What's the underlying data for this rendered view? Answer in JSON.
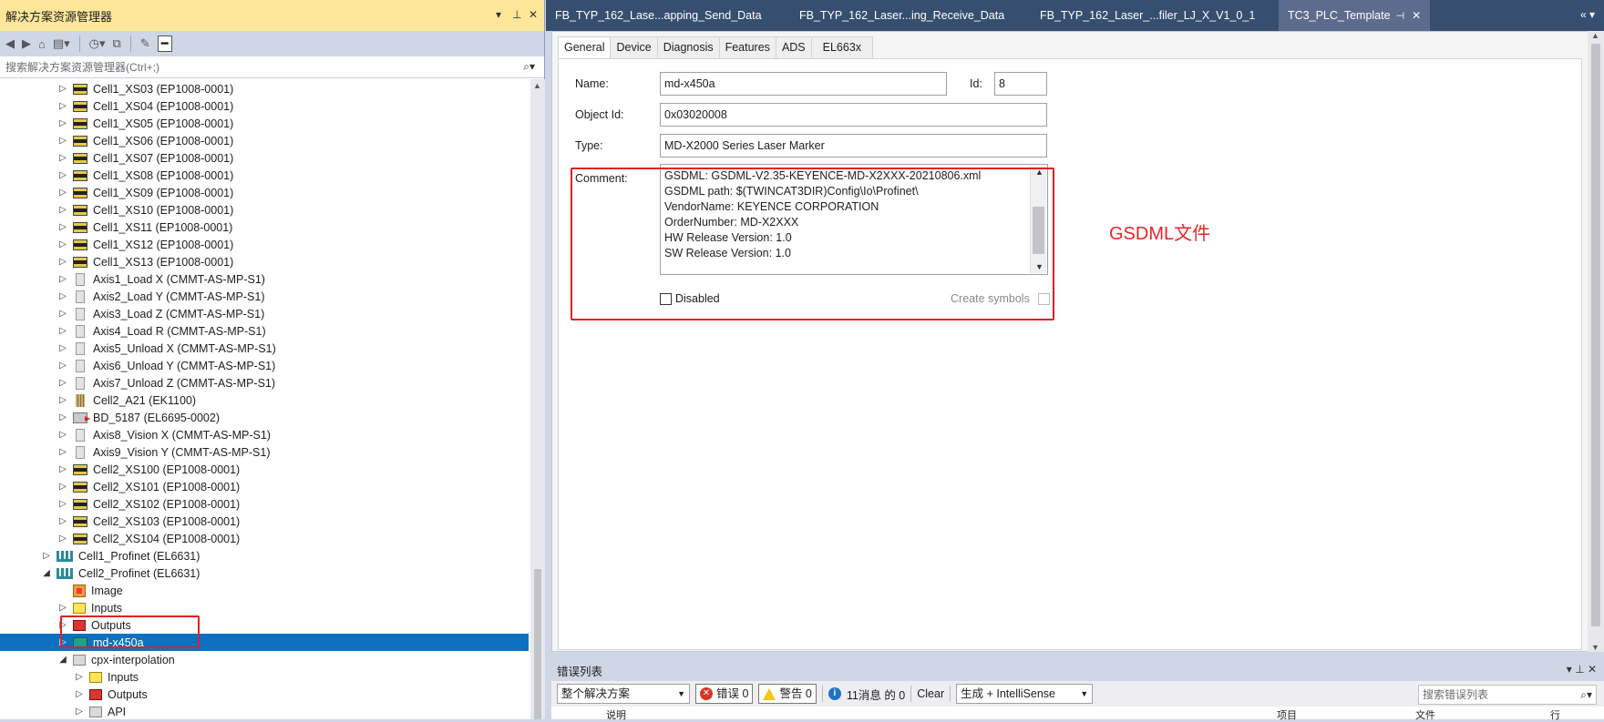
{
  "solution_explorer": {
    "title": "解决方案资源管理器",
    "search_placeholder": "搜索解决方案资源管理器(Ctrl+;)",
    "title_controls": {
      "dropdown": "▾",
      "pin": "⊥",
      "close": "✕"
    },
    "tree": [
      {
        "label": "Cell1_XS03 (EP1008-0001)",
        "icon": "module-icon",
        "arrow": "▷",
        "indent": 2
      },
      {
        "label": "Cell1_XS04 (EP1008-0001)",
        "icon": "module-icon",
        "arrow": "▷",
        "indent": 2
      },
      {
        "label": "Cell1_XS05 (EP1008-0001)",
        "icon": "module-icon",
        "arrow": "▷",
        "indent": 2
      },
      {
        "label": "Cell1_XS06 (EP1008-0001)",
        "icon": "module-icon",
        "arrow": "▷",
        "indent": 2
      },
      {
        "label": "Cell1_XS07 (EP1008-0001)",
        "icon": "module-icon",
        "arrow": "▷",
        "indent": 2
      },
      {
        "label": "Cell1_XS08 (EP1008-0001)",
        "icon": "module-icon",
        "arrow": "▷",
        "indent": 2
      },
      {
        "label": "Cell1_XS09 (EP1008-0001)",
        "icon": "module-icon",
        "arrow": "▷",
        "indent": 2
      },
      {
        "label": "Cell1_XS10 (EP1008-0001)",
        "icon": "module-icon",
        "arrow": "▷",
        "indent": 2
      },
      {
        "label": "Cell1_XS11 (EP1008-0001)",
        "icon": "module-icon",
        "arrow": "▷",
        "indent": 2
      },
      {
        "label": "Cell1_XS12 (EP1008-0001)",
        "icon": "module-icon",
        "arrow": "▷",
        "indent": 2
      },
      {
        "label": "Cell1_XS13 (EP1008-0001)",
        "icon": "module-icon",
        "arrow": "▷",
        "indent": 2
      },
      {
        "label": "Axis1_Load X (CMMT-AS-MP-S1)",
        "icon": "axis-icon",
        "arrow": "▷",
        "indent": 2
      },
      {
        "label": "Axis2_Load Y (CMMT-AS-MP-S1)",
        "icon": "axis-icon",
        "arrow": "▷",
        "indent": 2
      },
      {
        "label": "Axis3_Load Z (CMMT-AS-MP-S1)",
        "icon": "axis-icon",
        "arrow": "▷",
        "indent": 2
      },
      {
        "label": "Axis4_Load R (CMMT-AS-MP-S1)",
        "icon": "axis-icon",
        "arrow": "▷",
        "indent": 2
      },
      {
        "label": "Axis5_Unload X (CMMT-AS-MP-S1)",
        "icon": "axis-icon",
        "arrow": "▷",
        "indent": 2
      },
      {
        "label": "Axis6_Unload Y (CMMT-AS-MP-S1)",
        "icon": "axis-icon",
        "arrow": "▷",
        "indent": 2
      },
      {
        "label": "Axis7_Unload Z (CMMT-AS-MP-S1)",
        "icon": "axis-icon",
        "arrow": "▷",
        "indent": 2
      },
      {
        "label": "Cell2_A21 (EK1100)",
        "icon": "coupler-icon",
        "arrow": "▷",
        "indent": 2
      },
      {
        "label": "BD_5187 (EL6695-0002)",
        "icon": "bridge-icon",
        "arrow": "▷",
        "indent": 2
      },
      {
        "label": "Axis8_Vision X (CMMT-AS-MP-S1)",
        "icon": "axis-icon",
        "arrow": "▷",
        "indent": 2
      },
      {
        "label": "Axis9_Vision Y (CMMT-AS-MP-S1)",
        "icon": "axis-icon",
        "arrow": "▷",
        "indent": 2
      },
      {
        "label": "Cell2_XS100 (EP1008-0001)",
        "icon": "module-icon",
        "arrow": "▷",
        "indent": 2
      },
      {
        "label": "Cell2_XS101 (EP1008-0001)",
        "icon": "module-icon",
        "arrow": "▷",
        "indent": 2
      },
      {
        "label": "Cell2_XS102 (EP1008-0001)",
        "icon": "module-icon",
        "arrow": "▷",
        "indent": 2
      },
      {
        "label": "Cell2_XS103 (EP1008-0001)",
        "icon": "module-icon",
        "arrow": "▷",
        "indent": 2
      },
      {
        "label": "Cell2_XS104 (EP1008-0001)",
        "icon": "module-icon",
        "arrow": "▷",
        "indent": 2
      },
      {
        "label": "Cell1_Profinet (EL6631)",
        "icon": "profinet-icon",
        "arrow": "▷",
        "indent": 1
      },
      {
        "label": "Cell2_Profinet (EL6631)",
        "icon": "profinet-icon",
        "arrow": "◢",
        "indent": 1
      },
      {
        "label": "Image",
        "icon": "image-icon",
        "arrow": "",
        "indent": 2
      },
      {
        "label": "Inputs",
        "icon": "inputs-icon",
        "arrow": "▷",
        "indent": 2
      },
      {
        "label": "Outputs",
        "icon": "outputs-icon",
        "arrow": "▷",
        "indent": 2
      },
      {
        "label": "md-x450a",
        "icon": "device-icon",
        "arrow": "▷",
        "indent": 2,
        "selected": true
      },
      {
        "label": "cpx-interpolation",
        "icon": "cpx-icon",
        "arrow": "◢",
        "indent": 2
      },
      {
        "label": "Inputs",
        "icon": "inputs-icon",
        "arrow": "▷",
        "indent": 3
      },
      {
        "label": "Outputs",
        "icon": "outputs-icon",
        "arrow": "▷",
        "indent": 3
      },
      {
        "label": "API",
        "icon": "api-icon",
        "arrow": "▷",
        "indent": 3
      }
    ]
  },
  "doc_tabs": [
    {
      "label": "FB_TYP_162_Lase...apping_Send_Data",
      "active": false
    },
    {
      "label": "FB_TYP_162_Laser...ing_Receive_Data",
      "active": false
    },
    {
      "label": "FB_TYP_162_Laser_...filer_LJ_X_V1_0_1",
      "active": false
    },
    {
      "label": "TC3_PLC_Template",
      "active": true
    }
  ],
  "doc_tab_controls": {
    "pin": "⊣",
    "close": "✕",
    "overflow": "«  ▾"
  },
  "property_tabs": [
    "General",
    "Device",
    "Diagnosis",
    "Features",
    "ADS",
    "EL663x"
  ],
  "general": {
    "name_label": "Name:",
    "name_value": "md-x450a",
    "id_label": "Id:",
    "id_value": "8",
    "object_id_label": "Object Id:",
    "object_id_value": "0x03020008",
    "type_label": "Type:",
    "type_value": "MD-X2000 Series Laser Marker",
    "comment_label": "Comment:",
    "comment_lines": [
      "GSDML: GSDML-V2.35-KEYENCE-MD-X2XXX-20210806.xml",
      "GSDML path: $(TWINCAT3DIR)Config\\Io\\Profinet\\",
      "VendorName: KEYENCE CORPORATION",
      "OrderNumber: MD-X2XXX",
      "HW Release Version: 1.0",
      "SW Release Version: 1.0"
    ],
    "disabled_label": "Disabled",
    "create_symbols_label": "Create symbols"
  },
  "annotation_text": "GSDML文件",
  "error_list": {
    "title": "错误列表",
    "scope": "整个解决方案",
    "errors": "错误 0",
    "warnings": "警告 0",
    "messages": "11消息 的 0",
    "clear": "Clear",
    "build_filter": "生成 + IntelliSense",
    "search_placeholder": "搜索错误列表",
    "columns": [
      "说明",
      "项目",
      "文件",
      "行"
    ],
    "title_controls": "▾  ⊥  ✕"
  },
  "colors": {
    "selection": "#0e70c0",
    "annotation_red": "#e8262a",
    "tab_bar": "#364e6f",
    "explorer_title": "#ffe79a"
  }
}
